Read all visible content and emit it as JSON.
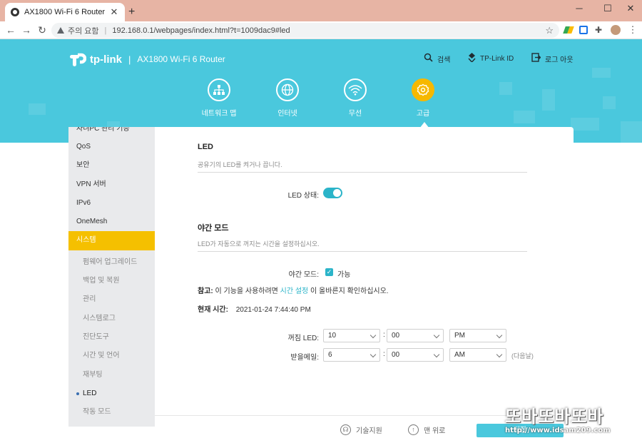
{
  "browser": {
    "tab_title": "AX1800 Wi-Fi 6 Router",
    "tab_close": "✕",
    "new_tab": "+",
    "security_warning": "주의 요함",
    "url": "192.168.0.1/webpages/index.html?t=1009dac9#led",
    "window_controls": [
      "─",
      "☐",
      "✕"
    ]
  },
  "router": {
    "brand": "tp-link",
    "model": "AX1800 Wi-Fi 6 Router",
    "header_links": {
      "search": "검색",
      "tplink_id": "TP-Link ID",
      "logout": "로그 아웃"
    },
    "main_nav": [
      {
        "label": "네트워크 맵",
        "icon": "network-map-icon",
        "active": false
      },
      {
        "label": "인터넷",
        "icon": "globe-icon",
        "active": false
      },
      {
        "label": "무선",
        "icon": "wifi-icon",
        "active": false
      },
      {
        "label": "고급",
        "icon": "gear-icon",
        "active": true
      }
    ],
    "accent_color": "#4ac8dd",
    "active_color": "#f5c000"
  },
  "sidebar": {
    "partial_item": "자녀PC 관리 기능",
    "items": [
      "QoS",
      "보안",
      "VPN 서버",
      "IPv6",
      "OneMesh",
      "시스템"
    ],
    "active_item": "시스템",
    "sub_items": [
      "펌웨어 업그레이드",
      "백업 및 복원",
      "관리",
      "시스템로그",
      "진단도구",
      "시간 및 언어",
      "재부팅",
      "LED",
      "작동 모드"
    ],
    "active_sub_item": "LED"
  },
  "led": {
    "title": "LED",
    "description": "공유기의 LED를 켜거나 끕니다.",
    "status_label": "LED 상태:",
    "status_on": true
  },
  "night_mode": {
    "title": "야간 모드",
    "description": "LED가 자동으로 꺼지는 시간을 설정하십시오.",
    "mode_label": "야간 모드:",
    "enable_label": "가능",
    "enabled": true,
    "note_prefix": "참고:",
    "note_text_1": "이 기능을 사용하려면",
    "note_link": "시간 설정",
    "note_text_2": "이 올바른지 확인하십시오.",
    "current_time_label": "현재 시간:",
    "current_time": "2021-01-24 7:44:40 PM",
    "off_label": "꺼짐 LED:",
    "off_hour": "10",
    "off_minute": "00",
    "off_ampm": "PM",
    "on_label": "받을메일:",
    "on_hour": "6",
    "on_minute": "00",
    "on_ampm": "AM",
    "next_day": "(다음날)",
    "colon": ":"
  },
  "footer": {
    "support": "기술지원",
    "top": "맨 위로",
    "save": "저장"
  },
  "watermark": {
    "big": "또바또바또바",
    "url": "http://www.idsam209.com"
  }
}
